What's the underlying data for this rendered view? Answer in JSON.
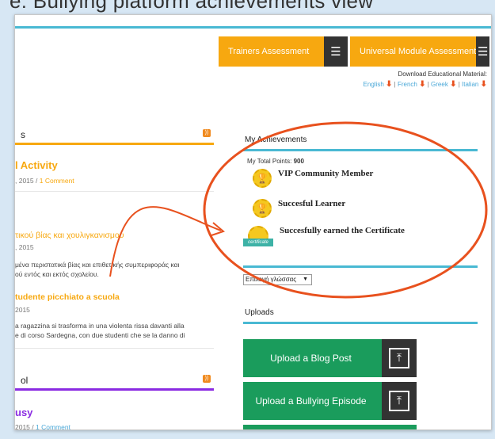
{
  "caption": "e: Bullying platform achievements view",
  "buttons": {
    "trainers": "Trainers Assessment",
    "universal": "Universal Module Assessment"
  },
  "download": {
    "title": "Download Educational Material:",
    "languages": [
      "English",
      "French",
      "Greek",
      "Italian"
    ],
    "arrow": "⬇",
    "sep": "|"
  },
  "news": {
    "heading": "s",
    "posts": [
      {
        "title": "l Activity",
        "date": ", 2015",
        "sep": " / ",
        "comments": "1 Comment"
      },
      {
        "title": "τικού βίας και χουλιγκανισμού",
        "date": ", 2015",
        "excerpt": [
          "μένα περιστατικά βίας και επιθετικής συμπεριφοράς και",
          "ού εντός και εκτός σχολείου."
        ]
      },
      {
        "title": "tudente picchiato a scuola",
        "date": "2015",
        "excerpt": [
          "a ragazzina si trasforma in una violenta rissa davanti alla",
          "e di corso Sardegna, con due studenti che se la danno di"
        ]
      }
    ]
  },
  "blog2": {
    "heading": "ol",
    "post": {
      "title": "usy",
      "date": "2015",
      "sep": " / ",
      "comments": "1 Comment"
    }
  },
  "achievements": {
    "heading": "My Achievements",
    "points_label": "My Total Points:",
    "points": "900",
    "items": [
      {
        "name": "VIP Community Member"
      },
      {
        "name": "Succesful Learner"
      },
      {
        "name": "Succesfully earned the Certificate",
        "badge_text": "certificate"
      }
    ]
  },
  "language_select": {
    "value": "Επιλογή γλώσσας"
  },
  "uploads": {
    "heading": "Uploads",
    "buttons": [
      "Upload a Blog Post",
      "Upload a Bullying Episode"
    ]
  },
  "colors": {
    "accent": "#f7a810",
    "teal": "#49b9d3",
    "green": "#1a9c5c",
    "purple": "#8a2be2",
    "highlight": "#e8511e"
  }
}
